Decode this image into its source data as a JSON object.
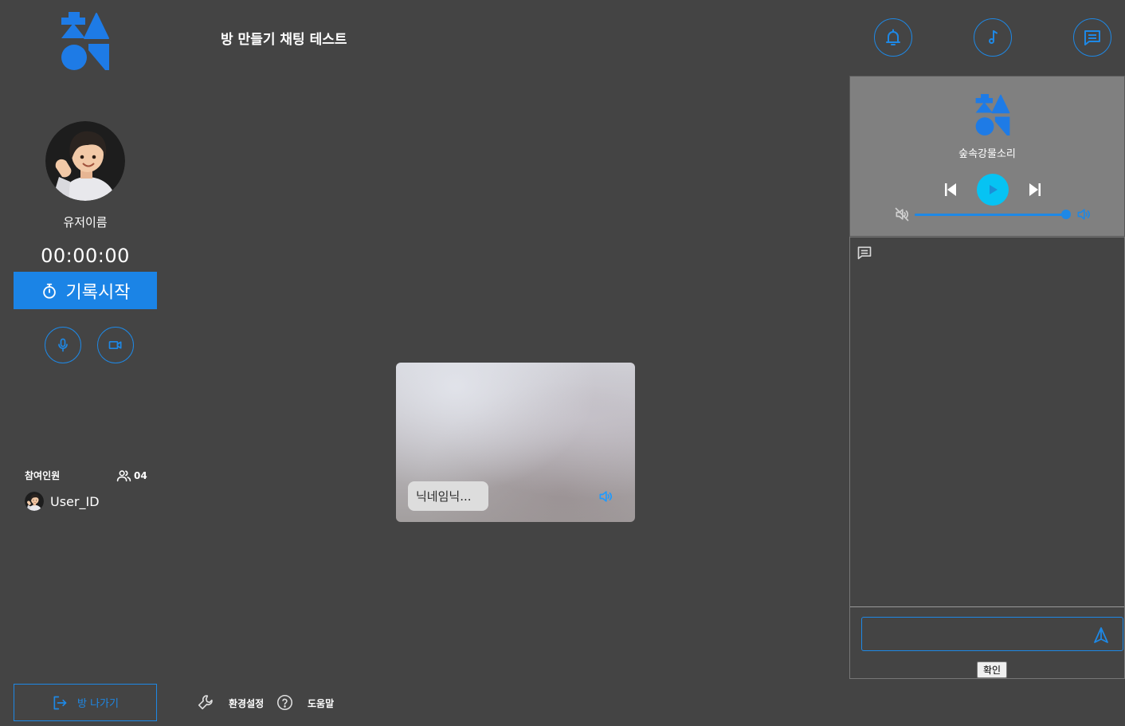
{
  "header": {
    "room_title": "방 만들기 채팅 테스트",
    "actions": [
      {
        "icon": "bell-icon"
      },
      {
        "icon": "music-note-icon"
      },
      {
        "icon": "chat-icon"
      }
    ]
  },
  "profile": {
    "username": "유저이름",
    "timer": "00:00:00",
    "record_label": "기록시작",
    "record_icon": "stopwatch-icon"
  },
  "media_controls": [
    {
      "icon": "mic-icon"
    },
    {
      "icon": "camera-icon"
    }
  ],
  "participants": {
    "label": "참여인원",
    "count": "04",
    "icon": "people-icon",
    "users": [
      {
        "name": "User_ID"
      }
    ]
  },
  "leave": {
    "label": "방 나가기",
    "icon": "exit-icon"
  },
  "footer": {
    "settings_label": "환경설정",
    "settings_icon": "wrench-icon",
    "help_label": "도움말",
    "help_icon": "question-circle-icon"
  },
  "video": {
    "nickname": "닉네임닉...",
    "audio_icon": "speaker-icon"
  },
  "music": {
    "track": "숲속강물소리",
    "volume_percent": 100,
    "controls": [
      "previous-icon",
      "play-icon",
      "next-icon"
    ]
  },
  "chat": {
    "input_value": "",
    "confirm_label": "확인",
    "send_icon": "send-icon"
  },
  "colors": {
    "background": "#444444",
    "accent": "#1e88e5",
    "record_button": "#1b84e6",
    "play_button": "#06c3f3",
    "music_panel": "#808080"
  }
}
